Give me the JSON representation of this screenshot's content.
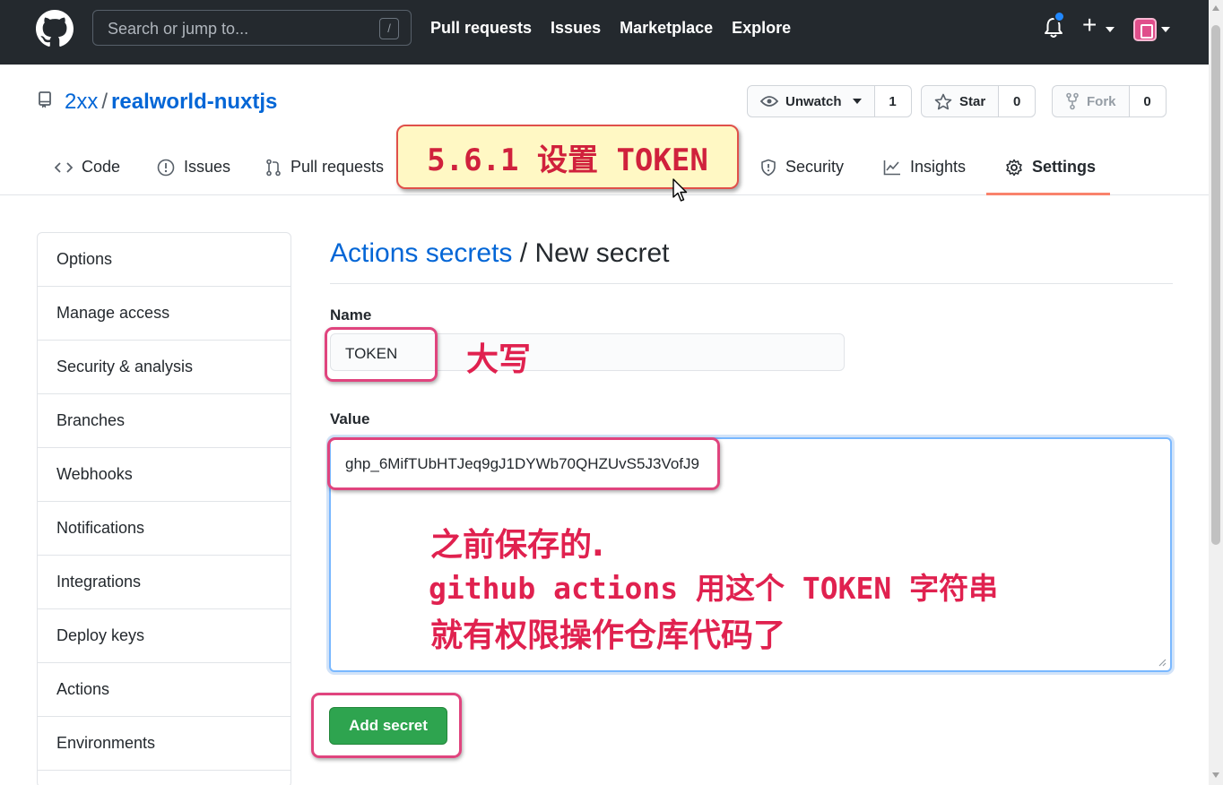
{
  "header": {
    "search_placeholder": "Search or jump to...",
    "search_shortcut": "/",
    "nav": [
      "Pull requests",
      "Issues",
      "Marketplace",
      "Explore"
    ],
    "plus_label": "+",
    "logo_icon": "github-octocat-icon"
  },
  "repo": {
    "owner": "2xx",
    "separator": "/",
    "name": "realworld-nuxtjs",
    "watch_label": "Unwatch",
    "watch_count": "1",
    "star_label": "Star",
    "star_count": "0",
    "fork_label": "Fork",
    "fork_count": "0"
  },
  "tabs": {
    "code": "Code",
    "issues": "Issues",
    "pull_requests": "Pull requests",
    "security": "Security",
    "insights": "Insights",
    "settings": "Settings"
  },
  "sidebar": {
    "items": [
      "Options",
      "Manage access",
      "Security & analysis",
      "Branches",
      "Webhooks",
      "Notifications",
      "Integrations",
      "Deploy keys",
      "Actions",
      "Environments"
    ]
  },
  "main": {
    "breadcrumb_link": "Actions secrets",
    "breadcrumb_sep": " / ",
    "breadcrumb_current": "New secret",
    "name_label": "Name",
    "name_value": "TOKEN",
    "value_label": "Value",
    "value_text": "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",
    "submit_label": "Add secret"
  },
  "annotations": {
    "title": "5.6.1 设置 TOKEN",
    "name_note": "大写",
    "value_note_1": "之前保存的.",
    "value_note_2": "github actions 用这个 TOKEN 字符串",
    "value_note_3": "就有权限操作仓库代码了"
  },
  "colors": {
    "header_bg": "#24292e",
    "link": "#0366d6",
    "primary_button": "#2ea44f",
    "tab_selected_underline": "#f9826c",
    "annotation": "#e0214f",
    "annotation_box": "#e0447e"
  }
}
